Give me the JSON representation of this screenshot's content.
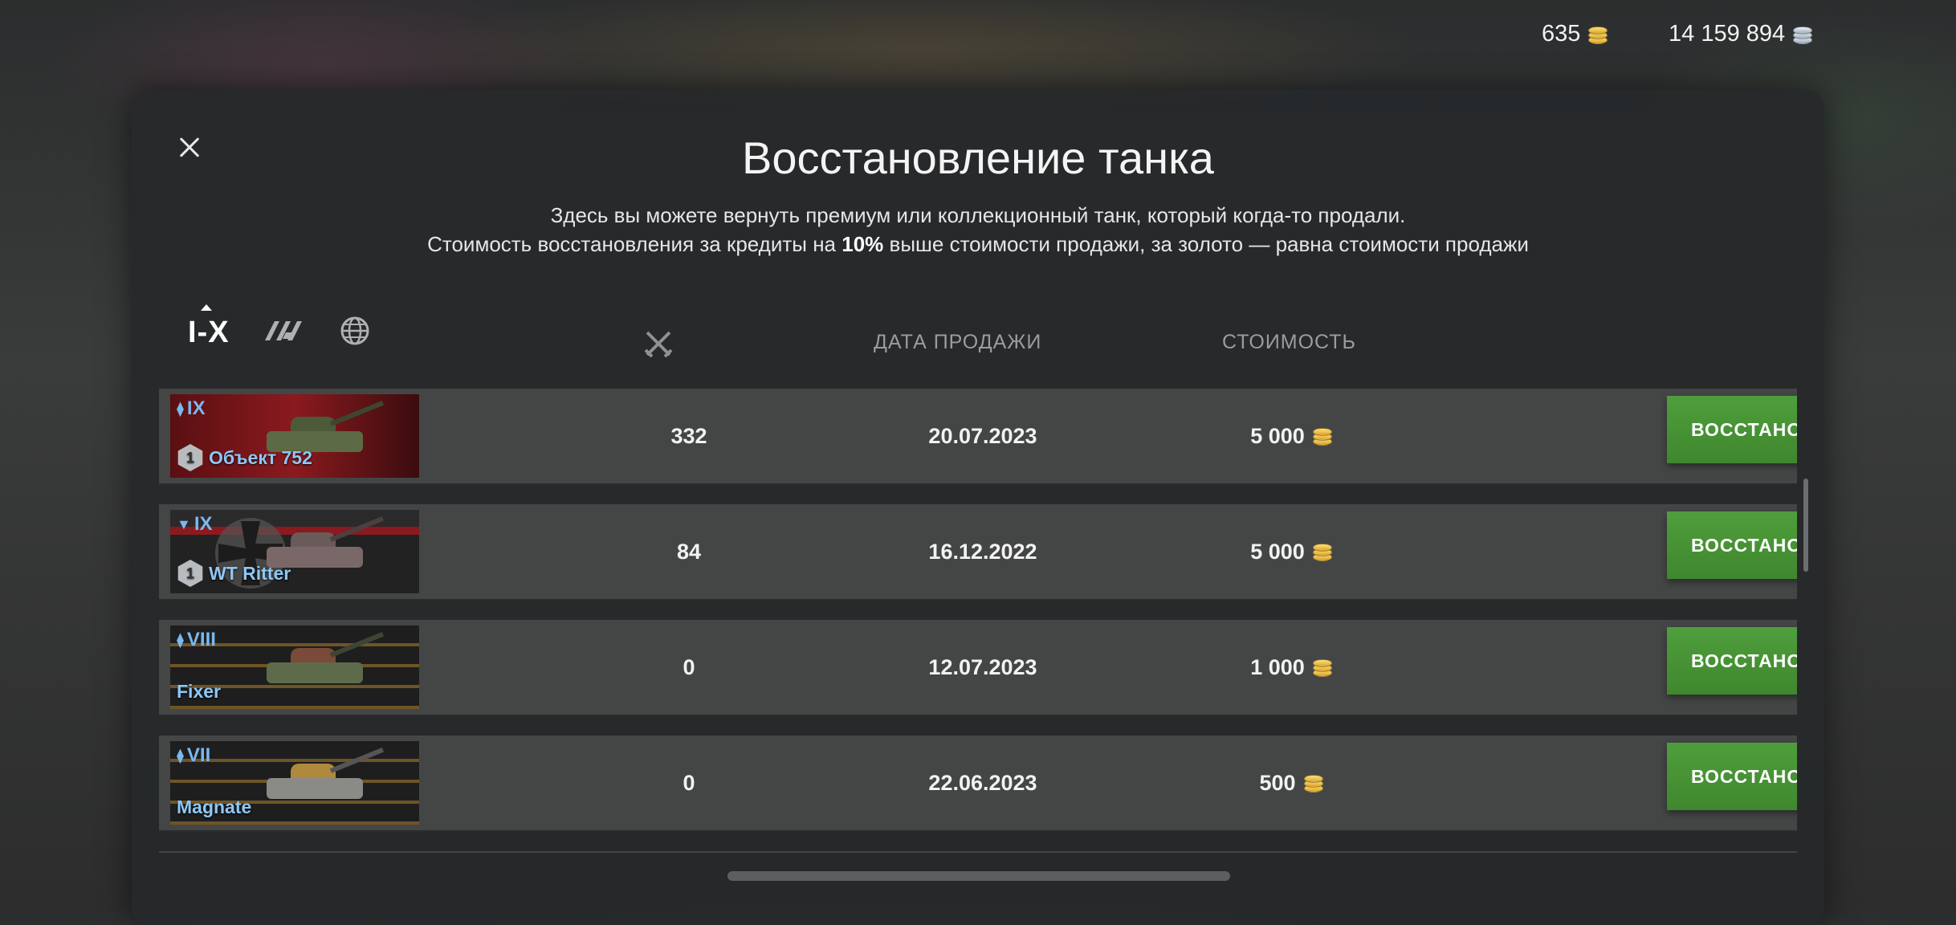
{
  "header": {
    "gold": "635",
    "credits": "14 159 894"
  },
  "dialog": {
    "title": "Восстановление танка",
    "subtitle_line1": "Здесь вы можете вернуть премиум или коллекционный танк, который когда-то продали.",
    "subtitle_line2_pre": "Стоимость восстановления за кредиты на ",
    "subtitle_line2_bold": "10%",
    "subtitle_line2_post": " выше стоимости продажи, за золото — равна стоимости продажи"
  },
  "filters": {
    "tier": "I-X"
  },
  "columns": {
    "sale_date": "ДАТА ПРОДАЖИ",
    "cost": "СТОИМОСТЬ"
  },
  "rows": [
    {
      "tier": "IX",
      "name": "Объект 752",
      "mastery": "1",
      "battles": "332",
      "date": "20.07.2023",
      "price": "5 000",
      "button": "ВОССТАНОВИТЬ"
    },
    {
      "tier": "IX",
      "name": "WT Ritter",
      "mastery": "1",
      "battles": "84",
      "date": "16.12.2022",
      "price": "5 000",
      "button": "ВОССТАНОВИТЬ"
    },
    {
      "tier": "VIII",
      "name": "Fixer",
      "battles": "0",
      "date": "12.07.2023",
      "price": "1 000",
      "button": "ВОССТАНОВИТЬ"
    },
    {
      "tier": "VII",
      "name": "Magnate",
      "battles": "0",
      "date": "22.06.2023",
      "price": "500",
      "button": "ВОССТАНОВИТЬ"
    }
  ],
  "icons": {
    "gold": "gold-coin-icon",
    "credits": "silver-coin-icon",
    "close": "close-icon",
    "vehicle_type_filter": "vehicle-type-icon",
    "nation_filter": "globe-icon",
    "battles_column": "crossed-swords-icon"
  },
  "colors": {
    "button_green": "#4f9e3c",
    "tank_name_blue": "#8fc7f5"
  }
}
